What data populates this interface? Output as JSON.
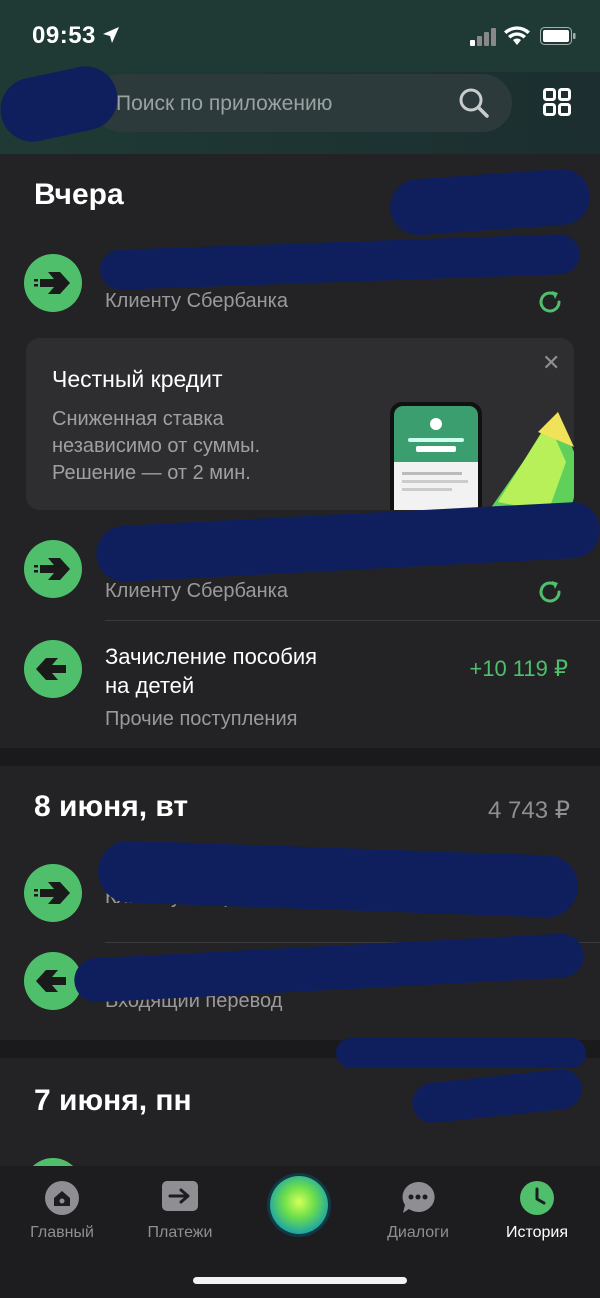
{
  "status_bar": {
    "time": "09:53"
  },
  "search": {
    "placeholder": "Поиск по приложению"
  },
  "sections": [
    {
      "title": "Вчера",
      "transactions": [
        {
          "title": "",
          "subtitle": "Клиенту Сбербанка",
          "amount": "",
          "direction": "out",
          "repeat": true
        },
        {
          "title": "",
          "subtitle": "Клиенту Сбербанка",
          "amount": "",
          "direction": "out",
          "repeat": true
        },
        {
          "title": "Зачисление пособия\nна детей",
          "subtitle": "Прочие поступления",
          "amount": "+10 119 ₽",
          "direction": "in",
          "repeat": false
        }
      ]
    },
    {
      "title": "8 июня, вт",
      "total": "4 743 ₽",
      "transactions": [
        {
          "title": "",
          "subtitle": "Клиенту Сбербанка",
          "amount": "",
          "direction": "out",
          "repeat": true
        },
        {
          "title": "",
          "subtitle": "Входящий перевод",
          "amount": "",
          "direction": "in",
          "repeat": false
        }
      ]
    },
    {
      "title": "7 июня, пн",
      "total": ""
    }
  ],
  "promo": {
    "title": "Честный кредит",
    "text_line1": "Сниженная ставка",
    "text_line2": "независимо от суммы.",
    "text_line3": "Решение — от 2 мин."
  },
  "tab_bar": {
    "items": [
      {
        "label": "Главный",
        "icon": "home-icon"
      },
      {
        "label": "Платежи",
        "icon": "transfer-icon"
      },
      {
        "label": "",
        "icon": "assistant-orb"
      },
      {
        "label": "Диалоги",
        "icon": "chat-icon"
      },
      {
        "label": "История",
        "icon": "clock-icon",
        "active": true
      }
    ]
  },
  "colors": {
    "accent": "#4fbf6b",
    "background": "#232325",
    "header": "#1f3a35"
  }
}
